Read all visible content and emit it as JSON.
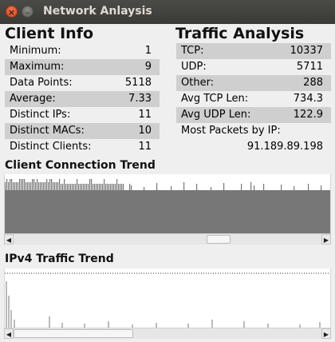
{
  "window": {
    "title": "Network Anlaysis",
    "close_glyph": "×",
    "minimize_glyph": "–"
  },
  "client_info": {
    "title": "Client Info",
    "rows": [
      {
        "label": "Minimum:",
        "value": "1"
      },
      {
        "label": "Maximum:",
        "value": "9"
      },
      {
        "label": "Data Points:",
        "value": "5118"
      },
      {
        "label": "Average:",
        "value": "7.33"
      },
      {
        "label": "Distinct IPs:",
        "value": "11"
      },
      {
        "label": "Distinct MACs:",
        "value": "10"
      },
      {
        "label": "Distinct Clients:",
        "value": "11"
      }
    ]
  },
  "traffic_analysis": {
    "title": "Traffic Analysis",
    "rows": [
      {
        "label": "TCP:",
        "value": "10337"
      },
      {
        "label": "UDP:",
        "value": "5711"
      },
      {
        "label": "Other:",
        "value": "288"
      },
      {
        "label": "Avg TCP  Len:",
        "value": "734.3"
      },
      {
        "label": "Avg UDP Len:",
        "value": "122.9"
      }
    ],
    "most_packets_label": "Most Packets by IP:",
    "most_packets_value": "91.189.89.198"
  },
  "client_trend": {
    "title": "Client Connection Trend",
    "fill_color": "#777777",
    "scroll_position": 0.68
  },
  "ipv4_trend": {
    "title": "IPv4 Traffic Trend",
    "line_color": "#777777",
    "scroll_position": 0.0
  },
  "scrollbar": {
    "left_arrow": "◀",
    "right_arrow": "▶"
  }
}
